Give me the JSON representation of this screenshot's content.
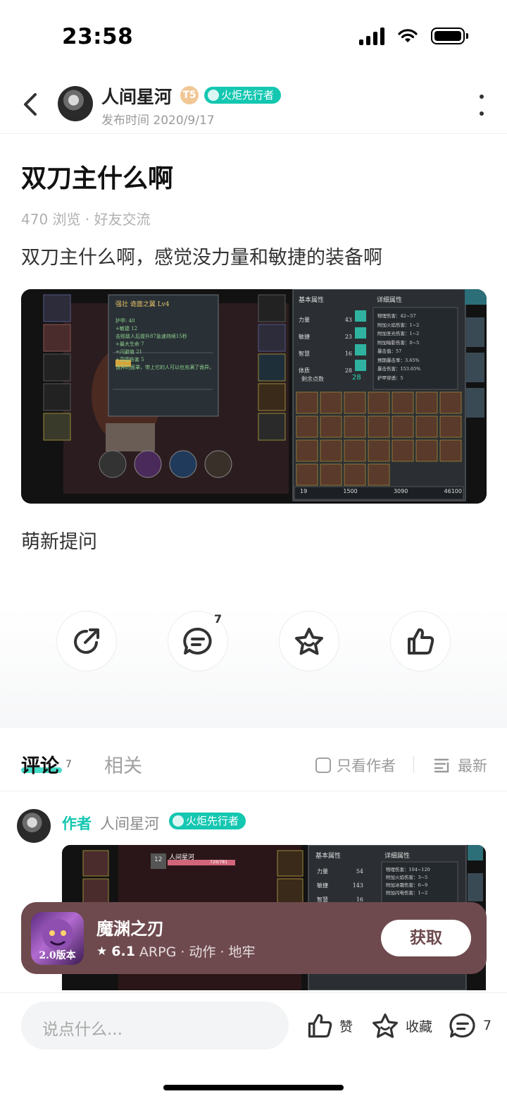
{
  "status_bar": {
    "time": "23:58"
  },
  "header": {
    "author_name": "人间星河",
    "level_badge": "T5",
    "title_badge": "火炬先行者",
    "post_time": "发布时间 2020/9/17"
  },
  "post": {
    "title": "双刀主什么啊",
    "meta": "470 浏览 · 好友交流",
    "body": "双刀主什么啊，感觉没力量和敏捷的装备啊",
    "tag": "萌新提问",
    "screenshot": {
      "tooltip_title": "强壮 诡面之翼 Lv4",
      "tooltip_lines": [
        "护甲: 40",
        "+敏捷 12",
        "击败敌人后提升87急速持续15秒",
        "+最大生命 7",
        "+闪避值 21",
        "+范围伤害 5",
        "诡异的面罩，带上它的人可以也充满了诡异。"
      ],
      "base_attr_title": "基本属性",
      "detail_attr_title": "详细属性",
      "attrs": [
        {
          "name": "力量",
          "value": "43"
        },
        {
          "name": "敏捷",
          "value": "23"
        },
        {
          "name": "智慧",
          "value": "16"
        },
        {
          "name": "体质",
          "value": "28"
        }
      ],
      "remaining_label": "剩余点数",
      "remaining_value": "28",
      "details": [
        "物理伤害：42~57",
        "附加火焰伤害：1~2",
        "附加圣光伤害：1~2",
        "附加暗影伤害：0~5",
        "暴击值：57",
        "预期暴击率：3.65%",
        "暴击伤害：153.65%",
        "护甲穿透：5"
      ],
      "footer": [
        "19",
        "1500",
        "3090",
        "46100"
      ]
    }
  },
  "actions": {
    "comment_count": "7"
  },
  "tabs": {
    "comment_label": "评论",
    "comment_count": "7",
    "related_label": "相关",
    "only_author": "只看作者",
    "sort_label": "最新"
  },
  "comment": {
    "author_tag": "作者",
    "author_name": "人间星河",
    "badge": "火炬先行者",
    "screenshot": {
      "player_name": "人间星河",
      "level": "12",
      "hp": "729/781",
      "base_attr_title": "基本属性",
      "detail_attr_title": "详细属性",
      "attrs": [
        {
          "name": "力量",
          "value": "54"
        },
        {
          "name": "敏捷",
          "value": "143"
        },
        {
          "name": "智慧",
          "value": "16"
        }
      ],
      "details": [
        "物理伤害：104~120",
        "附加火焰伤害：3~5",
        "附加冰霜伤害：6~9",
        "附加闪电伤害：1~2"
      ]
    }
  },
  "app_card": {
    "name": "魔渊之刃",
    "rating": "6.1",
    "genres": "ARPG · 动作 · 地牢",
    "icon_version": "2.0版本",
    "get_label": "获取"
  },
  "bottom_bar": {
    "placeholder": "说点什么...",
    "like_label": "赞",
    "collect_label": "收藏",
    "comment_count": "7"
  },
  "colors": {
    "accent": "#14c7b1",
    "app_card_bg": "#6e4a4e",
    "text_primary": "#111111",
    "text_muted": "#9a9a9a"
  }
}
